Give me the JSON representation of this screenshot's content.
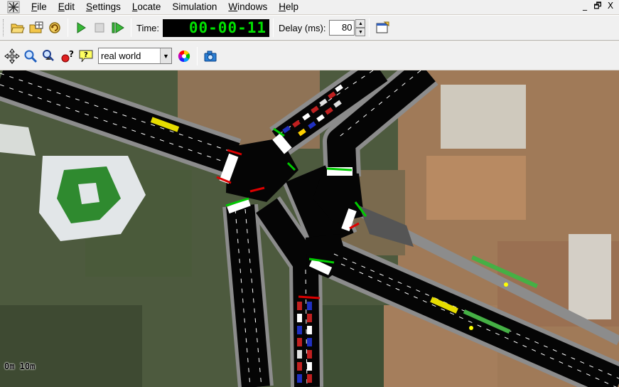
{
  "menubar": {
    "items": [
      {
        "label": "File",
        "key": "F",
        "rest": "ile"
      },
      {
        "label": "Edit",
        "key": "E",
        "rest": "dit"
      },
      {
        "label": "Settings",
        "key": "S",
        "rest": "ettings"
      },
      {
        "label": "Locate",
        "key": "L",
        "rest": "ocate"
      },
      {
        "label": "Simulation",
        "key": "",
        "rest": "Simulation"
      },
      {
        "label": "Windows",
        "key": "W",
        "rest": "indows"
      },
      {
        "label": "Help",
        "key": "H",
        "rest": "elp"
      }
    ],
    "window_controls": [
      "_",
      "🗗",
      "X"
    ]
  },
  "toolbar": {
    "icons": [
      "open-folder-icon",
      "open-network-icon",
      "reload-icon",
      "play-icon",
      "stop-icon",
      "step-icon"
    ],
    "time_label": "Time:",
    "time_value": "00-00-11",
    "delay_label": "Delay (ms):",
    "delay_value": "80",
    "edit_view_icon": "edit-viewport-icon"
  },
  "viewtoolbar": {
    "icons": [
      "recenter-icon",
      "locate-junction-icon",
      "locate-vehicle-icon",
      "breakpoint-icon",
      "tooltip-icon"
    ],
    "scheme_selected": "real world",
    "color_wheel_icon": "color-scheme-icon",
    "screenshot_icon": "screenshot-icon"
  },
  "canvas": {
    "scale_label": "0m  10m",
    "colors": {
      "road": "#050505",
      "sidewalk": "#8c8c8c",
      "lane_marking": "#ffffff",
      "vegetation": "#465a37",
      "rooftops": "#b48a64",
      "bus_yellow": "#e6dc00",
      "green_signal": "#00cc00",
      "red_signal": "#dd0000"
    }
  }
}
